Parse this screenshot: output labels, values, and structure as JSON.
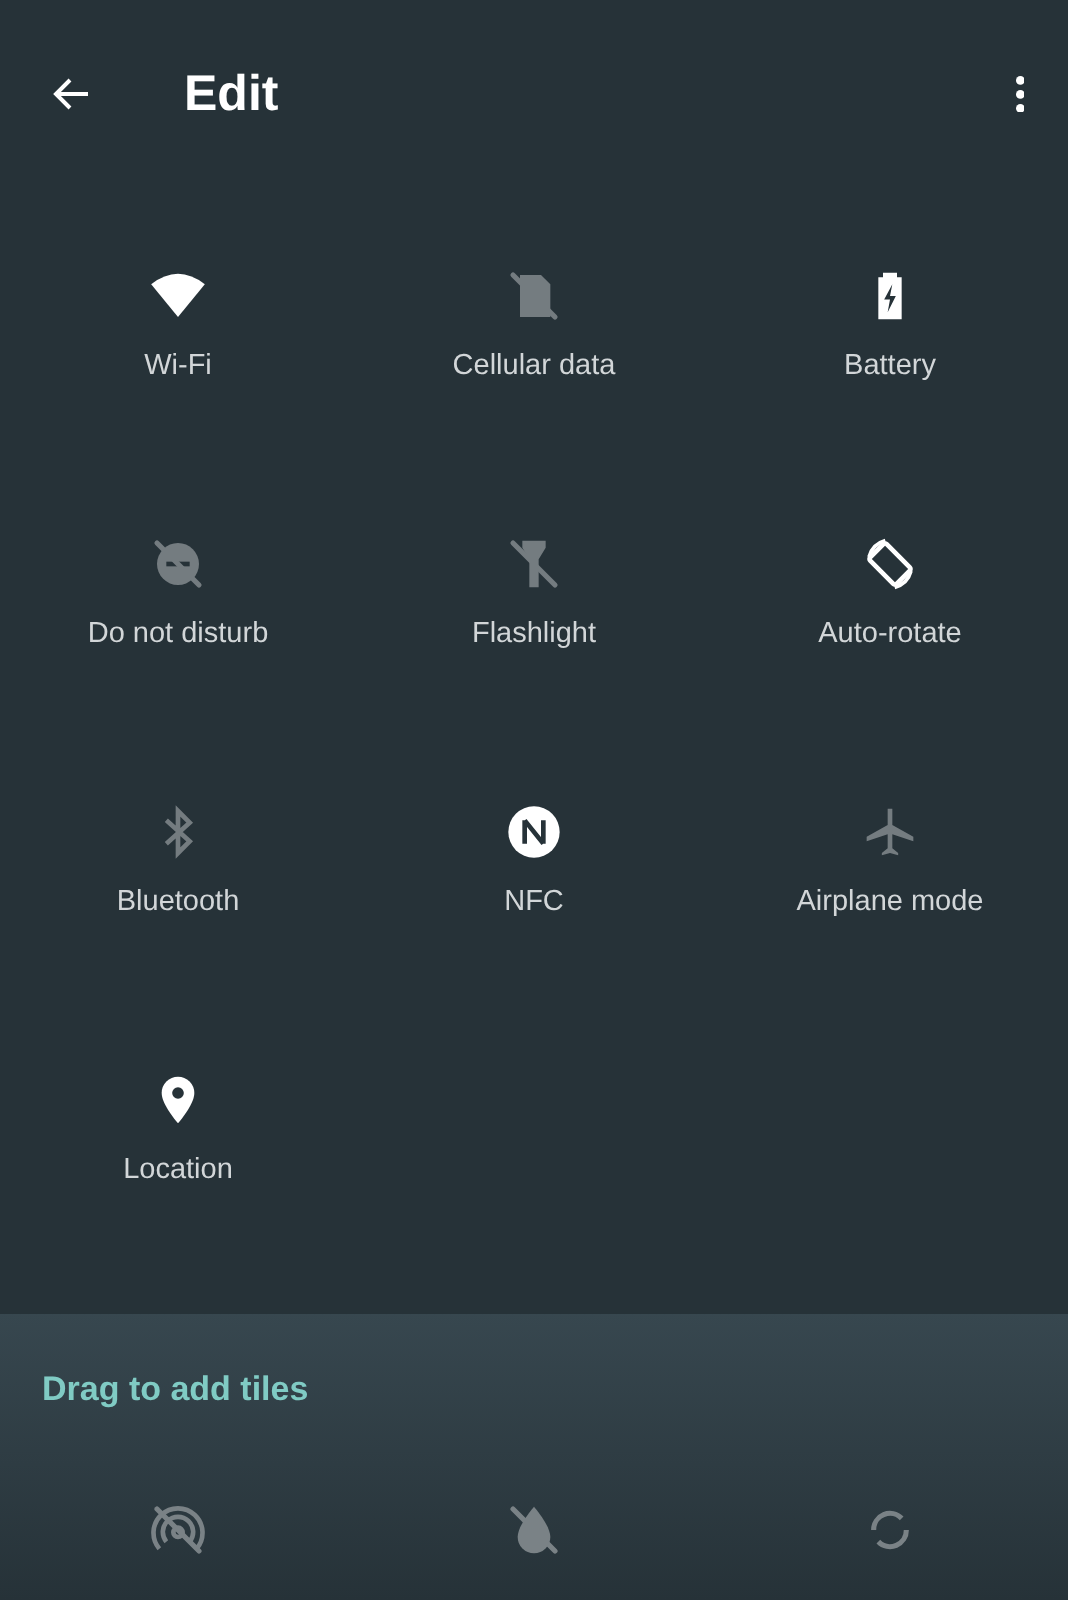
{
  "header": {
    "title": "Edit"
  },
  "tiles": [
    {
      "kind": "wifi",
      "label": "Wi-Fi",
      "on": true
    },
    {
      "kind": "cellular",
      "label": "Cellular data",
      "on": false
    },
    {
      "kind": "battery",
      "label": "Battery",
      "on": true
    },
    {
      "kind": "dnd",
      "label": "Do not disturb",
      "on": false
    },
    {
      "kind": "flashlight",
      "label": "Flashlight",
      "on": false
    },
    {
      "kind": "rotate",
      "label": "Auto-rotate",
      "on": true
    },
    {
      "kind": "bluetooth",
      "label": "Bluetooth",
      "on": false
    },
    {
      "kind": "nfc",
      "label": "NFC",
      "on": true
    },
    {
      "kind": "airplane",
      "label": "Airplane mode",
      "on": false
    },
    {
      "kind": "location",
      "label": "Location",
      "on": true
    }
  ],
  "available": {
    "title": "Drag to add tiles",
    "tiles": [
      {
        "kind": "hotspot"
      },
      {
        "kind": "datasaver"
      },
      {
        "kind": "sync"
      }
    ]
  }
}
